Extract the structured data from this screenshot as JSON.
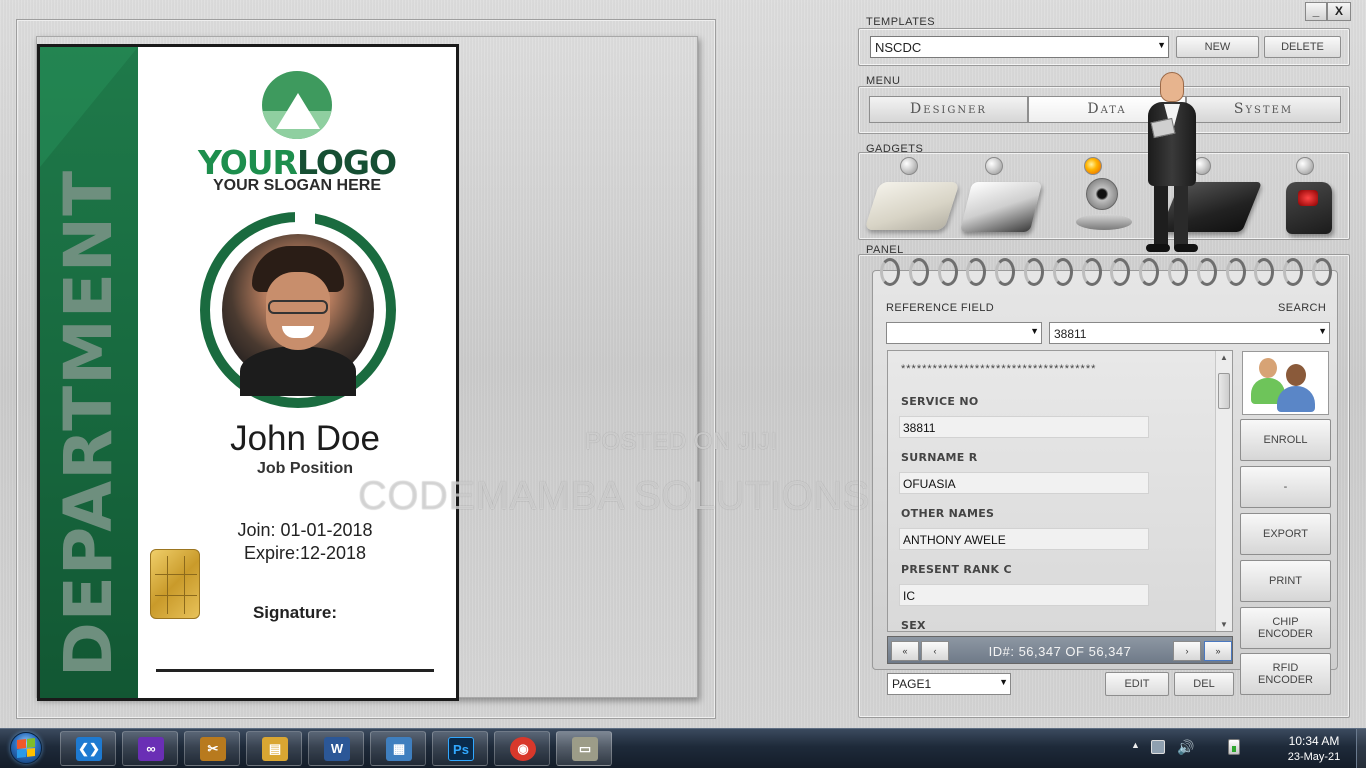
{
  "window": {
    "minimize_label": "_",
    "close_label": "X"
  },
  "id_card": {
    "department": "DEPARTMENT",
    "logo_your": "YOUR",
    "logo_logo": "LOGO",
    "slogan": "YOUR SLOGAN HERE",
    "name": "John Doe",
    "position": "Job Position",
    "join": "Join: 01-01-2018",
    "expire": "Expire:12-2018",
    "signature": "Signature:",
    "accent_color": "#1a6b3f"
  },
  "watermarks": {
    "posted": "POSTED ON JIJI",
    "company": "CODEMAMBA SOLUTIONS LTD"
  },
  "templates": {
    "label": "TEMPLATES",
    "selected": "NSCDC",
    "new_label": "NEW",
    "delete_label": "DELETE"
  },
  "menu": {
    "label": "MENU",
    "tabs": [
      {
        "label": "Designer"
      },
      {
        "label": "Data",
        "active": true
      },
      {
        "label": "System"
      }
    ]
  },
  "gadgets": {
    "label": "GADGETS",
    "items": [
      {
        "icon": "card-reader-icon",
        "led": "off"
      },
      {
        "icon": "card-printer-icon",
        "led": "off"
      },
      {
        "icon": "webcam-icon",
        "led": "on"
      },
      {
        "icon": "signature-pad-icon",
        "led": "off"
      },
      {
        "icon": "fingerprint-scanner-icon",
        "led": "off"
      }
    ]
  },
  "panel": {
    "label": "PANEL",
    "reference_field_label": "REFERENCE FIELD",
    "reference_field_value": "",
    "search_label": "SEARCH",
    "search_value": "38811",
    "separator": "*************************************",
    "fields": [
      {
        "label": "SERVICE NO",
        "value": "38811"
      },
      {
        "label": "SURNAME  R",
        "value": "OFUASIA"
      },
      {
        "label": "OTHER NAMES",
        "value": "ANTHONY AWELE"
      },
      {
        "label": "PRESENT RANK  C",
        "value": "IC"
      },
      {
        "label": "SEX",
        "value": ""
      }
    ],
    "side_buttons": {
      "enroll": "ENROLL",
      "dash": "-",
      "export": "EXPORT",
      "print": "PRINT",
      "chip_encoder": "CHIP ENCODER",
      "rfid_encoder": "RFID ENCODER"
    },
    "navigation": {
      "first": "«",
      "prev": "‹",
      "record_text": "ID#:  56,347  OF  56,347",
      "next": "›",
      "last": "»"
    },
    "page_select": "PAGE1",
    "edit_label": "EDIT",
    "del_label": "DEL"
  },
  "taskbar": {
    "apps": [
      {
        "name": "vscode",
        "icon": "vscode-icon",
        "glyph": "❮❯",
        "color": "#1e7ad1"
      },
      {
        "name": "infinity",
        "icon": "infinity-icon",
        "glyph": "∞",
        "color": "#6a2fb5"
      },
      {
        "name": "tools",
        "icon": "tools-icon",
        "glyph": "✂",
        "color": "#b87a1e"
      },
      {
        "name": "explorer",
        "icon": "folder-icon",
        "glyph": "▤",
        "color": "#d9a632"
      },
      {
        "name": "word",
        "icon": "word-icon",
        "glyph": "W",
        "color": "#2b5797"
      },
      {
        "name": "control-panel",
        "icon": "control-panel-icon",
        "glyph": "▦",
        "color": "#3f7fbf"
      },
      {
        "name": "photoshop",
        "icon": "photoshop-icon",
        "glyph": "Ps",
        "color": "#0a2a4a"
      },
      {
        "name": "chrome",
        "icon": "chrome-icon",
        "glyph": "◉",
        "color": "#d8382b"
      },
      {
        "name": "id-designer",
        "icon": "id-card-app-icon",
        "glyph": "▭",
        "color": "#9c9c88",
        "active": true
      }
    ],
    "tray": {
      "arrow": "▲",
      "volume": "🔊",
      "time": "10:34 AM",
      "date": "23-May-21"
    }
  }
}
